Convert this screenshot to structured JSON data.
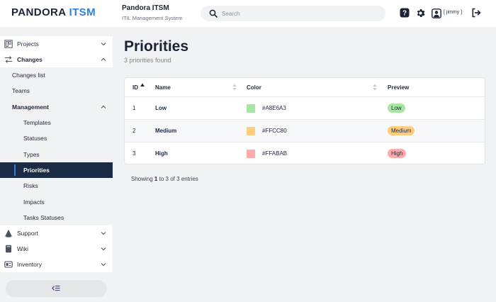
{
  "header": {
    "logo_main": "PANDORA ",
    "logo_accent": "ITSM",
    "app_title": "Pandora ITSM",
    "app_subtitle": "ITIL Management System",
    "search_placeholder": "Search",
    "user_name": "[ jimmy ]",
    "icons": [
      "search-icon",
      "help-icon",
      "gear-icon",
      "user-icon",
      "logout-icon"
    ]
  },
  "sidebar": {
    "projects": "Projects",
    "changes": "Changes",
    "changes_list": "Changes list",
    "teams": "Teams",
    "management": "Management",
    "templates": "Templates",
    "statuses": "Statuses",
    "types": "Types",
    "priorities": "Priorities",
    "risks": "Risks",
    "impacts": "Impacts",
    "tasks_statuses": "Tasks Statuses",
    "support": "Support",
    "wiki": "Wiki",
    "inventory": "Inventory"
  },
  "main": {
    "title": "Priorities",
    "subtitle": "3 priorities found",
    "columns": {
      "id": "ID",
      "name": "Name",
      "color": "Color",
      "preview": "Preview"
    },
    "rows": [
      {
        "id": "1",
        "name": "Low",
        "color": "#A8E6A3",
        "preview": "Low"
      },
      {
        "id": "2",
        "name": "Medium",
        "color": "#FFCC80",
        "preview": "Medium"
      },
      {
        "id": "3",
        "name": "High",
        "color": "#FFABAB",
        "preview": "High"
      }
    ],
    "footer": {
      "showing": "Showing",
      "from": "1",
      "to_word": "to",
      "to": "3",
      "of_word": "of",
      "total": "3",
      "entries": "entries"
    }
  },
  "colors": {
    "accent": "#2f7de1",
    "nav_active_bg": "#1b2a45",
    "low": "#A8E6A3",
    "medium": "#FFCC80",
    "high": "#FFABAB"
  }
}
